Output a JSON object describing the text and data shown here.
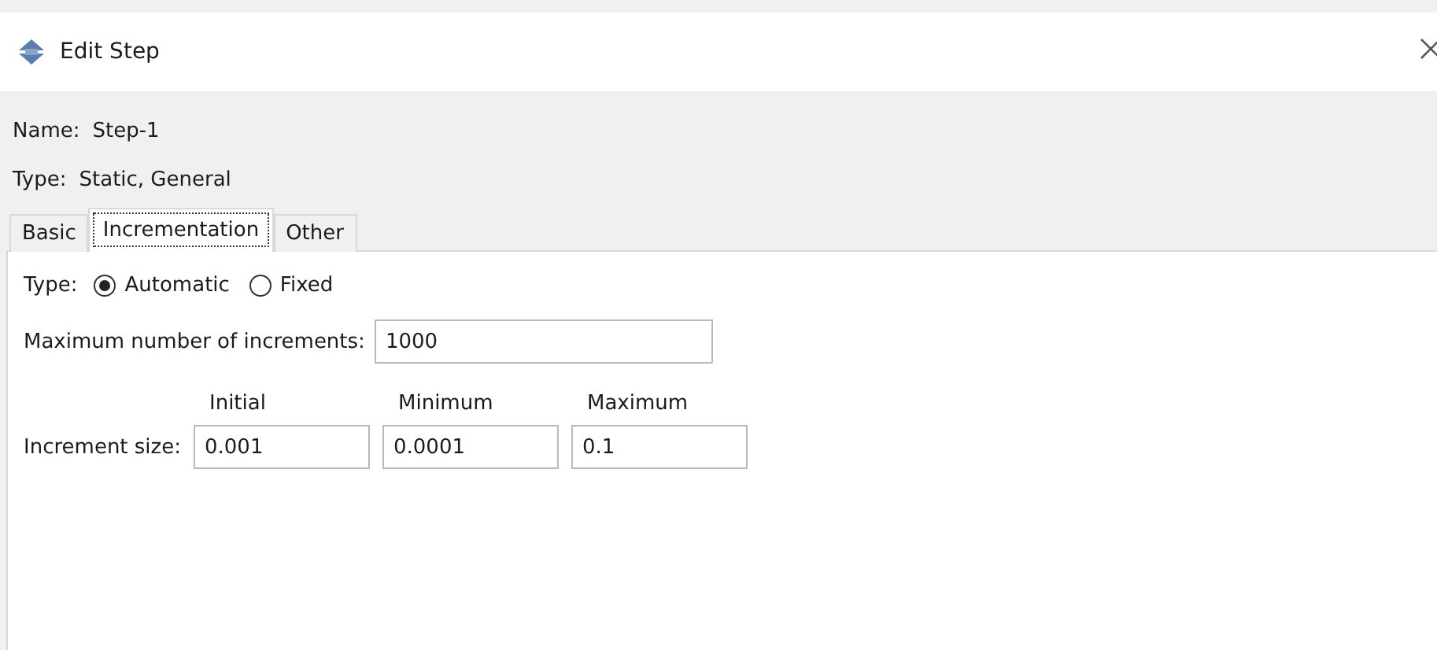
{
  "window": {
    "title": "Edit Step"
  },
  "name": {
    "label": "Name:",
    "value": "Step-1"
  },
  "type": {
    "label": "Type:",
    "value": "Static, General"
  },
  "tabs": [
    {
      "label": "Basic",
      "selected": false
    },
    {
      "label": "Incrementation",
      "selected": true
    },
    {
      "label": "Other",
      "selected": false
    }
  ],
  "incrementation": {
    "type_label": "Type:",
    "type_options": [
      {
        "label": "Automatic",
        "selected": true
      },
      {
        "label": "Fixed",
        "selected": false
      }
    ],
    "max_increments": {
      "label": "Maximum number of increments:",
      "value": "1000"
    },
    "increment_size": {
      "label": "Increment size:",
      "columns": [
        "Initial",
        "Minimum",
        "Maximum"
      ],
      "values": [
        "0.001",
        "0.0001",
        "0.1"
      ]
    }
  }
}
